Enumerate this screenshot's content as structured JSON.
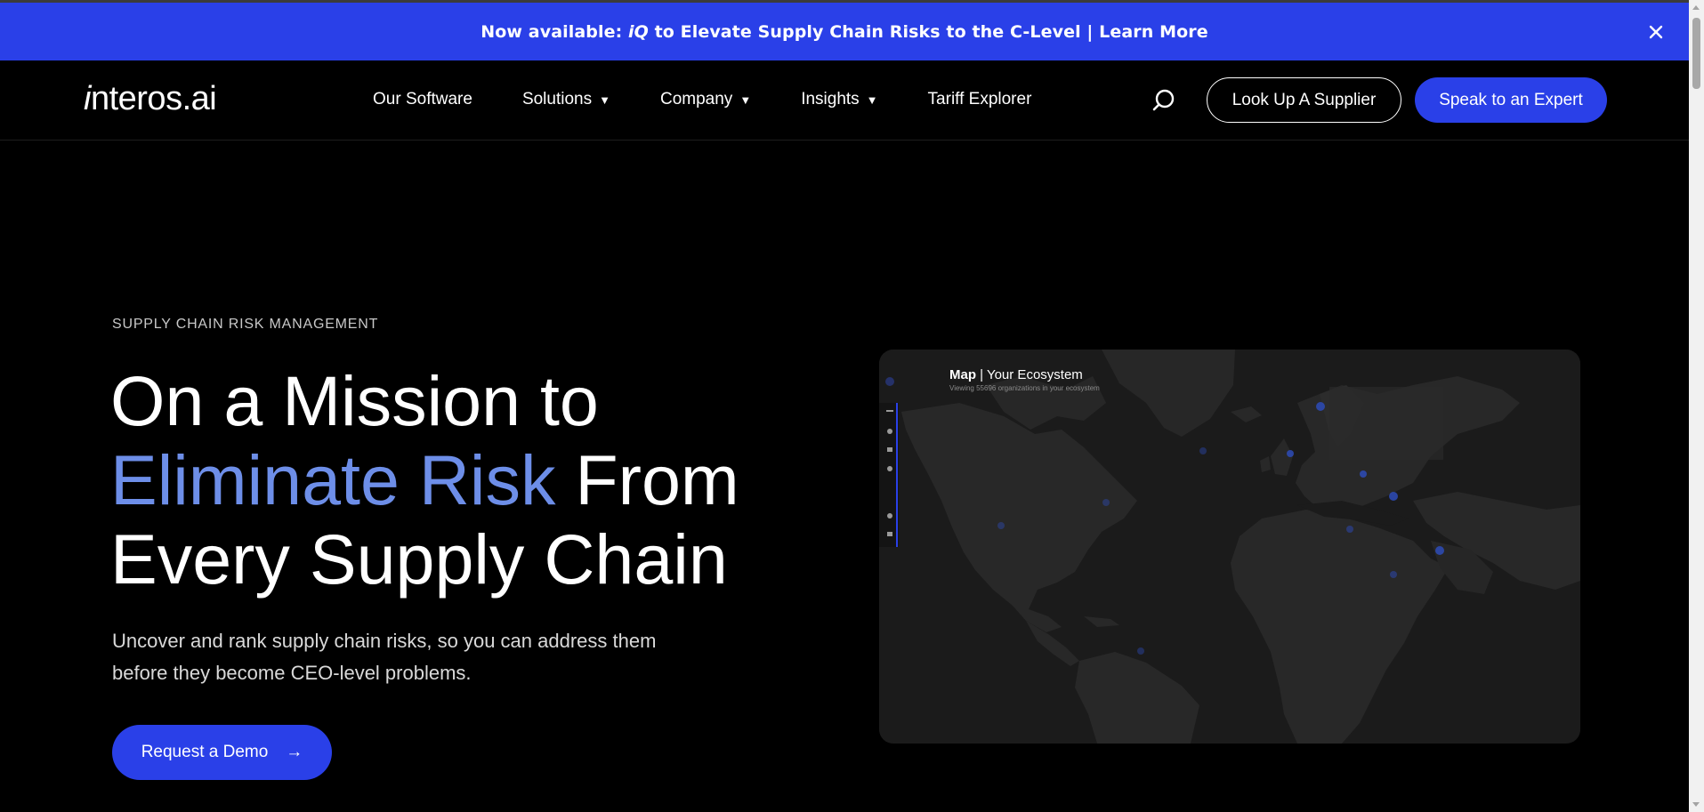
{
  "announcement": {
    "prefix": "Now available: ",
    "iq": "iQ",
    "suffix": " to Elevate Supply Chain Risks to the C-Level | Learn More",
    "close_icon": "close-icon"
  },
  "nav": {
    "logo_i": "i",
    "logo_rest": "nteros.ai",
    "items": [
      {
        "label": "Our Software",
        "dropdown": false
      },
      {
        "label": "Solutions",
        "dropdown": true
      },
      {
        "label": "Company",
        "dropdown": true
      },
      {
        "label": "Insights",
        "dropdown": true
      },
      {
        "label": "Tariff Explorer",
        "dropdown": false
      }
    ],
    "caret": "▼",
    "search_icon": "search-icon",
    "lookup_label": "Look Up A Supplier",
    "expert_label": "Speak to an Expert"
  },
  "hero": {
    "eyebrow": "SUPPLY CHAIN RISK MANAGEMENT",
    "title_line1": "On a Mission to",
    "title_accent": "Eliminate Risk",
    "title_line2_rest": " From",
    "title_line3": "Every Supply Chain",
    "subtitle_line1": "Uncover and rank supply chain risks, so you can address them",
    "subtitle_line2": "before they become CEO-level problems.",
    "demo_label": "Request a Demo",
    "demo_arrow": "→"
  },
  "map": {
    "title_bold": "Map",
    "title_rest": " | Your Ecosystem",
    "subtitle": "Viewing 55696 organizations in your ecosystem"
  },
  "colors": {
    "accent": "#2a40e8",
    "accent_text": "#6d8ee8",
    "background": "#000000"
  }
}
